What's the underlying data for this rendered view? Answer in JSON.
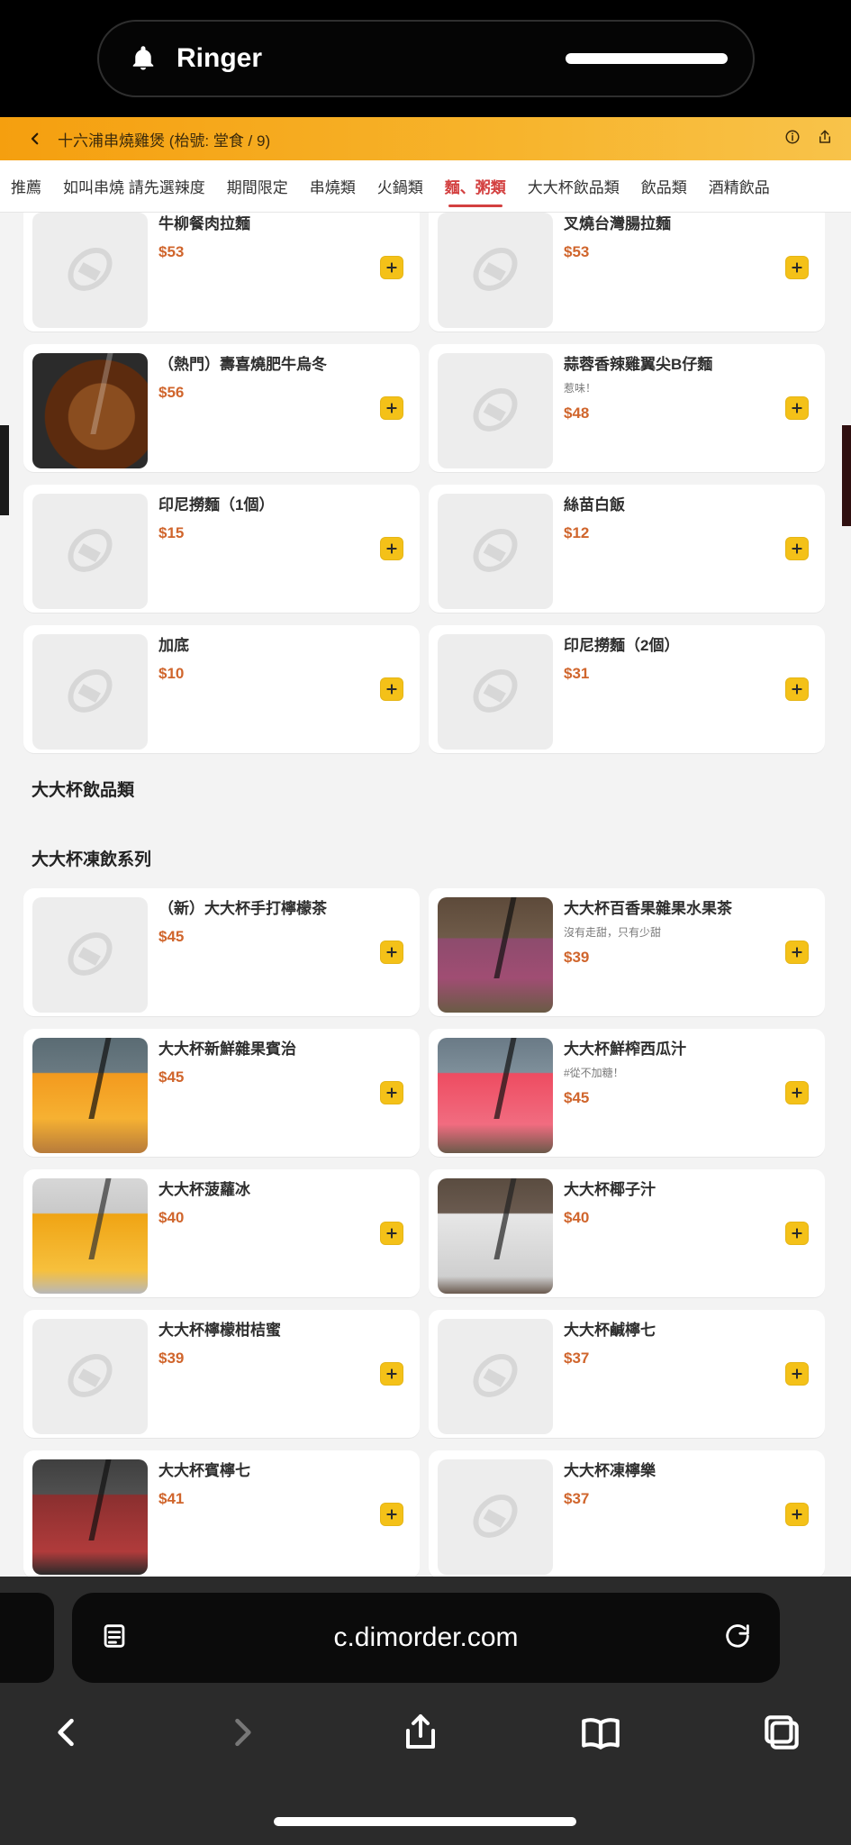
{
  "dynamic_island": {
    "title": "Ringer",
    "icon": "bell-icon"
  },
  "header": {
    "title": "十六浦串燒雞煲 (枱號: 堂食 / 9)"
  },
  "tabs": [
    {
      "label": "推薦",
      "active": false
    },
    {
      "label": "如叫串燒 請先選辣度",
      "active": false
    },
    {
      "label": "期間限定",
      "active": false
    },
    {
      "label": "串燒類",
      "active": false
    },
    {
      "label": "火鍋類",
      "active": false
    },
    {
      "label": "麵、粥類",
      "active": true
    },
    {
      "label": "大大杯飲品類",
      "active": false
    },
    {
      "label": "飲品類",
      "active": false
    },
    {
      "label": "酒精飲品",
      "active": false
    }
  ],
  "menu": {
    "group1": [
      {
        "name": "牛柳餐肉拉麵",
        "price": "$53",
        "note": "",
        "thumb": "placeholder"
      },
      {
        "name": "叉燒台灣腸拉麵",
        "price": "$53",
        "note": "",
        "thumb": "placeholder"
      },
      {
        "name": "（熱門）壽喜燒肥牛烏冬",
        "price": "$56",
        "note": "",
        "thumb": "beef"
      },
      {
        "name": "蒜蓉香辣雞翼尖B仔麵",
        "price": "$48",
        "note": "惹味！",
        "thumb": "placeholder"
      },
      {
        "name": "印尼撈麵（1個）",
        "price": "$15",
        "note": "",
        "thumb": "placeholder"
      },
      {
        "name": "絲苗白飯",
        "price": "$12",
        "note": "",
        "thumb": "placeholder"
      },
      {
        "name": "加底",
        "price": "$10",
        "note": "",
        "thumb": "placeholder"
      },
      {
        "name": "印尼撈麵（2個）",
        "price": "$31",
        "note": "",
        "thumb": "placeholder"
      }
    ],
    "section_title": "大大杯飲品類",
    "subsection_title": "大大杯凍飲系列",
    "group2": [
      {
        "name": "（新）大大杯手打檸檬茶",
        "price": "$45",
        "note": "",
        "thumb": "placeholder"
      },
      {
        "name": "大大杯百香果雜果水果茶",
        "price": "$39",
        "note": "沒有走甜，只有少甜",
        "thumb": "passion"
      },
      {
        "name": "大大杯新鮮雜果賓治",
        "price": "$45",
        "note": "",
        "thumb": "orange"
      },
      {
        "name": "大大杯鮮榨西瓜汁",
        "price": "$45",
        "note": "#從不加糖！",
        "thumb": "water"
      },
      {
        "name": "大大杯菠蘿冰",
        "price": "$40",
        "note": "",
        "thumb": "pine"
      },
      {
        "name": "大大杯椰子汁",
        "price": "$40",
        "note": "",
        "thumb": "coco"
      },
      {
        "name": "大大杯檸檬柑桔蜜",
        "price": "$39",
        "note": "",
        "thumb": "placeholder"
      },
      {
        "name": "大大杯鹹檸七",
        "price": "$37",
        "note": "",
        "thumb": "placeholder"
      },
      {
        "name": "大大杯賓檸七",
        "price": "$41",
        "note": "",
        "thumb": "berry"
      },
      {
        "name": "大大杯凍檸樂",
        "price": "$37",
        "note": "",
        "thumb": "placeholder"
      }
    ]
  },
  "browser": {
    "url": "c.dimorder.com"
  },
  "colors": {
    "accent": "#d0652c",
    "header_orange": "#f2a012",
    "add_button": "#f4c118",
    "active_tab": "#d34040"
  }
}
